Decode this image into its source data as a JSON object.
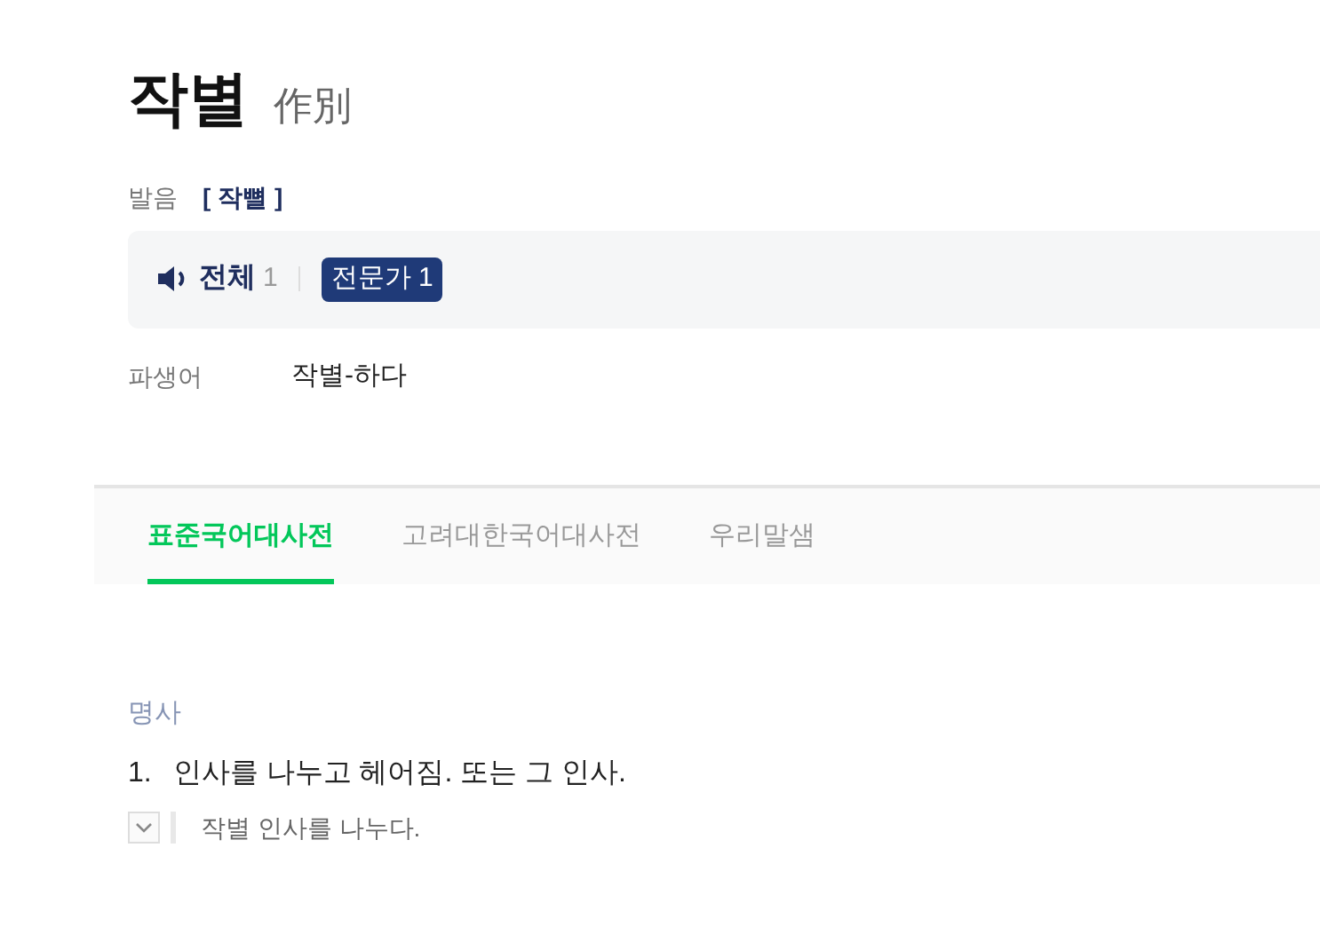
{
  "entry": {
    "headword": "작별",
    "hanja": "作別"
  },
  "pronunciation": {
    "label": "발음",
    "value": "[ 작뼐 ]"
  },
  "audio": {
    "label": "전체",
    "count": "1",
    "badge_label": "전문가",
    "badge_count": "1"
  },
  "derived": {
    "label": "파생어",
    "value": "작별-하다"
  },
  "tabs": [
    {
      "label": "표준국어대사전",
      "selected": true
    },
    {
      "label": "고려대한국어대사전",
      "selected": false
    },
    {
      "label": "우리말샘",
      "selected": false
    }
  ],
  "part_of_speech": "명사",
  "senses": [
    {
      "number": "1.",
      "text": "인사를 나누고 헤어짐. 또는 그 인사.",
      "examples": [
        {
          "text": "작별 인사를 나누다.",
          "expanded": false
        }
      ]
    }
  ]
}
